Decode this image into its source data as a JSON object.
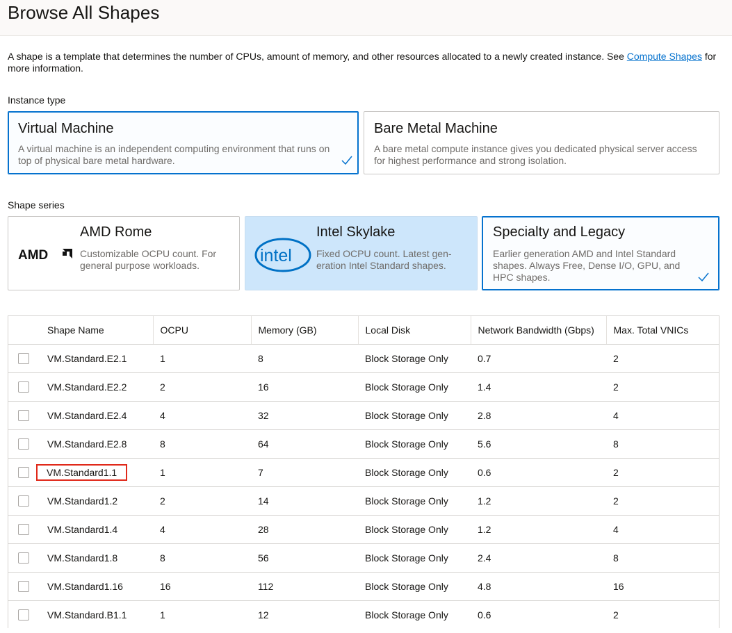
{
  "page": {
    "title": "Browse All Shapes",
    "intro_text": "A shape is a template that determines the number of CPUs, amount of memory, and other resources allocated to a newly created instance. See ",
    "intro_link": "Compute Shapes",
    "intro_text_after": " for more information."
  },
  "instance_type": {
    "label": "Instance type",
    "options": [
      {
        "title": "Virtual Machine",
        "description": "A virtual machine is an independent computing environment that runs on top of physical bare metal hardware.",
        "selected": true
      },
      {
        "title": "Bare Metal Machine",
        "description": "A bare metal compute instance gives you dedicated physical server access for highest performance and strong isolation.",
        "selected": false
      }
    ]
  },
  "shape_series": {
    "label": "Shape series",
    "options": [
      {
        "title": "AMD Rome",
        "logo": "AMD",
        "description": "Customizable OCPU count. For general purpose workloads.",
        "selected": false
      },
      {
        "title": "Intel Skylake",
        "logo": "intel",
        "description": "Fixed OCPU count. Latest gen-eration Intel Standard shapes.",
        "selected": false,
        "highlighted": true
      },
      {
        "title": "Specialty and Legacy",
        "description": "Earlier generation AMD and Intel Standard shapes. Always Free, Dense I/O, GPU, and HPC shapes.",
        "selected": true
      }
    ]
  },
  "table": {
    "columns": [
      "Shape Name",
      "OCPU",
      "Memory (GB)",
      "Local Disk",
      "Network Bandwidth (Gbps)",
      "Max. Total VNICs"
    ],
    "rows": [
      {
        "name": "VM.Standard.E2.1",
        "ocpu": "1",
        "memory": "8",
        "disk": "Block Storage Only",
        "bandwidth": "0.7",
        "vnics": "2"
      },
      {
        "name": "VM.Standard.E2.2",
        "ocpu": "2",
        "memory": "16",
        "disk": "Block Storage Only",
        "bandwidth": "1.4",
        "vnics": "2"
      },
      {
        "name": "VM.Standard.E2.4",
        "ocpu": "4",
        "memory": "32",
        "disk": "Block Storage Only",
        "bandwidth": "2.8",
        "vnics": "4"
      },
      {
        "name": "VM.Standard.E2.8",
        "ocpu": "8",
        "memory": "64",
        "disk": "Block Storage Only",
        "bandwidth": "5.6",
        "vnics": "8"
      },
      {
        "name": "VM.Standard1.1",
        "ocpu": "1",
        "memory": "7",
        "disk": "Block Storage Only",
        "bandwidth": "0.6",
        "vnics": "2",
        "highlighted": true
      },
      {
        "name": "VM.Standard1.2",
        "ocpu": "2",
        "memory": "14",
        "disk": "Block Storage Only",
        "bandwidth": "1.2",
        "vnics": "2"
      },
      {
        "name": "VM.Standard1.4",
        "ocpu": "4",
        "memory": "28",
        "disk": "Block Storage Only",
        "bandwidth": "1.2",
        "vnics": "4"
      },
      {
        "name": "VM.Standard1.8",
        "ocpu": "8",
        "memory": "56",
        "disk": "Block Storage Only",
        "bandwidth": "2.4",
        "vnics": "8"
      },
      {
        "name": "VM.Standard1.16",
        "ocpu": "16",
        "memory": "112",
        "disk": "Block Storage Only",
        "bandwidth": "4.8",
        "vnics": "16"
      },
      {
        "name": "VM.Standard.B1.1",
        "ocpu": "1",
        "memory": "12",
        "disk": "Block Storage Only",
        "bandwidth": "0.6",
        "vnics": "2"
      }
    ]
  },
  "colors": {
    "accent": "#0572ce",
    "highlight_card": "#cde6fb",
    "callout_border": "#e0291a"
  }
}
